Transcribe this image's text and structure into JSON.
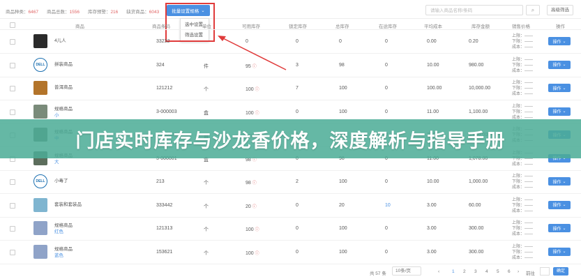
{
  "stats": [
    {
      "label": "商品种类：",
      "value": "6467"
    },
    {
      "label": "商品总数：",
      "value": "1556"
    },
    {
      "label": "库存预警：",
      "value": "216"
    },
    {
      "label": "缺货商品：",
      "value": "6043"
    }
  ],
  "batch_button": "批量设置规格",
  "dropdown_items": [
    "选中设置",
    "筛选设置"
  ],
  "search_placeholder": "请输入商品名称/条码",
  "filter_button": "高级筛选",
  "columns": [
    "商品",
    "商品条码",
    "单位",
    "可用库存",
    "锁定库存",
    "总库存",
    "在途库存",
    "平均成本",
    "库存金额",
    "销售价格",
    "操作"
  ],
  "rows": [
    {
      "name": "4儿人",
      "sub": "",
      "barcode": "33232",
      "unit": "",
      "avail": "0",
      "warn": false,
      "locked": "0",
      "total": "0",
      "transit": "0",
      "cost": "0.00",
      "amount": "0.20",
      "thumb": "#2a2a2a"
    },
    {
      "name": "拼装商品",
      "sub": "",
      "barcode": "324",
      "unit": "件",
      "avail": "95",
      "warn": true,
      "locked": "3",
      "total": "98",
      "transit": "0",
      "cost": "10.00",
      "amount": "980.00",
      "thumb": "dell"
    },
    {
      "name": "普洱商品",
      "sub": "",
      "barcode": "121212",
      "unit": "个",
      "avail": "100",
      "warn": true,
      "locked": "7",
      "total": "100",
      "transit": "0",
      "cost": "100.00",
      "amount": "10,000.00",
      "thumb": "#b3742a"
    },
    {
      "name": "规格商品",
      "sub": "小",
      "barcode": "3-000003",
      "unit": "盒",
      "avail": "100",
      "warn": true,
      "locked": "0",
      "total": "100",
      "transit": "0",
      "cost": "11.00",
      "amount": "1,100.00",
      "thumb": "#7a8b7a"
    },
    {
      "name": "规格商品",
      "sub": "中",
      "barcode": "3-000002",
      "unit": "盒",
      "avail": "100",
      "warn": true,
      "locked": "0",
      "total": "100",
      "transit": "0",
      "cost": "11.00",
      "amount": "1,100.00",
      "thumb": "#6b7c6b"
    },
    {
      "name": "规格商品",
      "sub": "大",
      "barcode": "3-000001",
      "unit": "盒",
      "avail": "98",
      "warn": true,
      "locked": "0",
      "total": "98",
      "transit": "0",
      "cost": "11.00",
      "amount": "1,078.00",
      "thumb": "#5c6d5c"
    },
    {
      "name": "小毒了",
      "sub": "",
      "barcode": "213",
      "unit": "个",
      "avail": "98",
      "warn": true,
      "locked": "2",
      "total": "100",
      "transit": "0",
      "cost": "10.00",
      "amount": "1,000.00",
      "thumb": "dell"
    },
    {
      "name": "套装和套装品",
      "sub": "",
      "barcode": "333442",
      "unit": "个",
      "avail": "20",
      "warn": true,
      "locked": "0",
      "total": "20",
      "transit": "10",
      "cost": "3.00",
      "amount": "60.00",
      "thumb": "#7fb5d0"
    },
    {
      "name": "规格商品",
      "sub": "红色",
      "barcode": "121313",
      "unit": "个",
      "avail": "100",
      "warn": true,
      "locked": "0",
      "total": "100",
      "transit": "0",
      "cost": "3.00",
      "amount": "300.00",
      "thumb": "#8fa3c8"
    },
    {
      "name": "规格商品",
      "sub": "蓝色",
      "barcode": "153621",
      "unit": "个",
      "avail": "100",
      "warn": true,
      "locked": "0",
      "total": "100",
      "transit": "0",
      "cost": "3.00",
      "amount": "300.00",
      "thumb": "#8fa3c8"
    }
  ],
  "price_lines": [
    "上限：——",
    "下限：——",
    "成本：——"
  ],
  "op_label": "操作",
  "pager": {
    "total": "共 57 条",
    "size": "10条/页",
    "pages": [
      "1",
      "2",
      "3",
      "4",
      "5",
      "6"
    ],
    "goto": "前往",
    "confirm": "确定"
  },
  "banner": "门店实时库存与沙龙香价格，深度解析与指导手册",
  "colors": {
    "accent": "#4a90e2",
    "warn": "#e06666",
    "banner": "#4cac96",
    "highlight": "#e03a3a"
  }
}
